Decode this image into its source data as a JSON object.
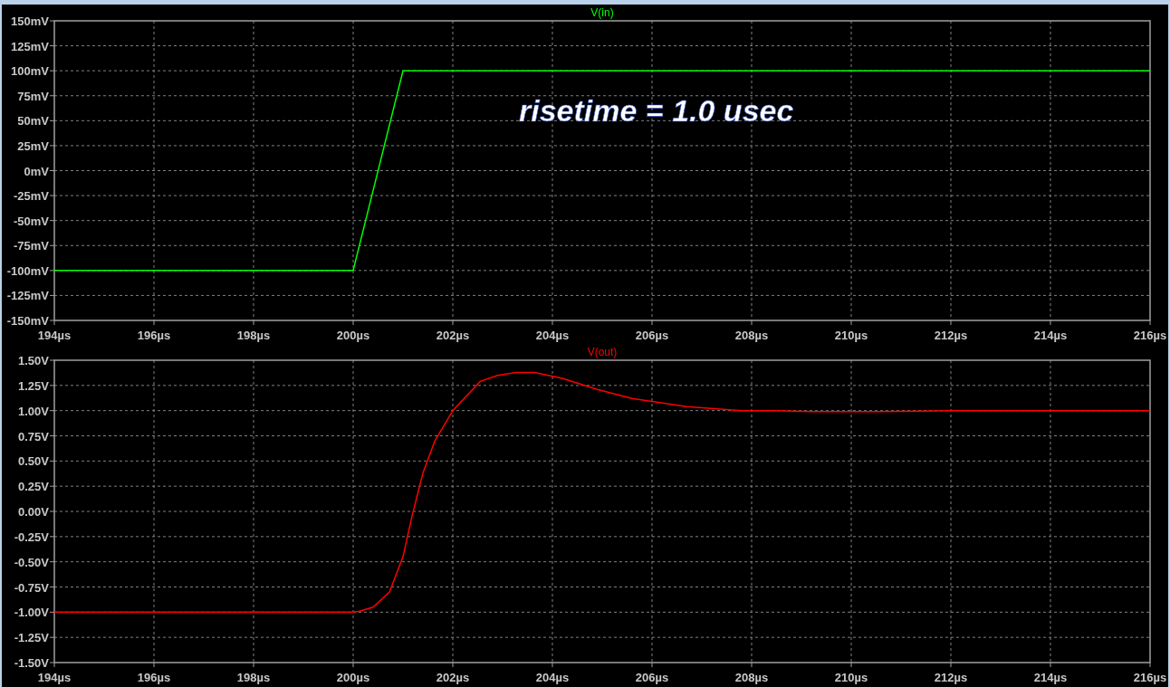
{
  "plots": [
    {
      "chart_data": {
        "type": "line",
        "x": [
          194,
          200,
          201,
          216
        ],
        "series": [
          {
            "name": "V(in)",
            "color": "#00ff00",
            "values": [
              -100,
              -100,
              100,
              100
            ]
          }
        ],
        "xlim": [
          194,
          216
        ],
        "ylim": [
          -150,
          150
        ],
        "xticks": [
          {
            "value": 194,
            "label": "194µs"
          },
          {
            "value": 196,
            "label": "196µs"
          },
          {
            "value": 198,
            "label": "198µs"
          },
          {
            "value": 200,
            "label": "200µs"
          },
          {
            "value": 202,
            "label": "202µs"
          },
          {
            "value": 204,
            "label": "204µs"
          },
          {
            "value": 206,
            "label": "206µs"
          },
          {
            "value": 208,
            "label": "208µs"
          },
          {
            "value": 210,
            "label": "210µs"
          },
          {
            "value": 212,
            "label": "212µs"
          },
          {
            "value": 214,
            "label": "214µs"
          },
          {
            "value": 216,
            "label": "216µs"
          }
        ],
        "yticks": [
          {
            "value": 150,
            "label": "150mV"
          },
          {
            "value": 125,
            "label": "125mV"
          },
          {
            "value": 100,
            "label": "100mV"
          },
          {
            "value": 75,
            "label": "75mV"
          },
          {
            "value": 50,
            "label": "50mV"
          },
          {
            "value": 25,
            "label": "25mV"
          },
          {
            "value": 0,
            "label": "0mV"
          },
          {
            "value": -25,
            "label": "-25mV"
          },
          {
            "value": -50,
            "label": "-50mV"
          },
          {
            "value": -75,
            "label": "-75mV"
          },
          {
            "value": -100,
            "label": "-100mV"
          },
          {
            "value": -125,
            "label": "-125mV"
          },
          {
            "value": -150,
            "label": "-150mV"
          }
        ],
        "grid": true,
        "annotations": [
          "risetime = 1.0 usec"
        ]
      }
    },
    {
      "chart_data": {
        "type": "line",
        "x": [
          194,
          200,
          200.13,
          200.4,
          200.73,
          201.0,
          201.18,
          201.4,
          201.64,
          202.0,
          202.3,
          202.55,
          202.9,
          203.27,
          203.64,
          204.2,
          204.9,
          205.6,
          206.7,
          207.8,
          208.5,
          209.2,
          210.5,
          212,
          214.6,
          216
        ],
        "series": [
          {
            "name": "V(out)",
            "color": "#ff0000",
            "values": [
              -1,
              -1,
              -0.99,
              -0.95,
              -0.8,
              -0.45,
              -0.05,
              0.38,
              0.7,
              1.0,
              1.16,
              1.29,
              1.35,
              1.38,
              1.38,
              1.32,
              1.21,
              1.12,
              1.04,
              1.0,
              1.0,
              0.99,
              0.99,
              1.0,
              1.0,
              1.0
            ]
          }
        ],
        "xlim": [
          194,
          216
        ],
        "ylim": [
          -1.5,
          1.5
        ],
        "xticks": [
          {
            "value": 194,
            "label": "194µs"
          },
          {
            "value": 196,
            "label": "196µs"
          },
          {
            "value": 198,
            "label": "198µs"
          },
          {
            "value": 200,
            "label": "200µs"
          },
          {
            "value": 202,
            "label": "202µs"
          },
          {
            "value": 204,
            "label": "204µs"
          },
          {
            "value": 206,
            "label": "206µs"
          },
          {
            "value": 208,
            "label": "208µs"
          },
          {
            "value": 210,
            "label": "210µs"
          },
          {
            "value": 212,
            "label": "212µs"
          },
          {
            "value": 214,
            "label": "214µs"
          },
          {
            "value": 216,
            "label": "216µs"
          }
        ],
        "yticks": [
          {
            "value": 1.5,
            "label": "1.50V"
          },
          {
            "value": 1.25,
            "label": "1.25V"
          },
          {
            "value": 1.0,
            "label": "1.00V"
          },
          {
            "value": 0.75,
            "label": "0.75V"
          },
          {
            "value": 0.5,
            "label": "0.50V"
          },
          {
            "value": 0.25,
            "label": "0.25V"
          },
          {
            "value": 0,
            "label": "0.00V"
          },
          {
            "value": -0.25,
            "label": "-0.25V"
          },
          {
            "value": -0.5,
            "label": "-0.50V"
          },
          {
            "value": -0.75,
            "label": "-0.75V"
          },
          {
            "value": -1.0,
            "label": "-1.00V"
          },
          {
            "value": -1.25,
            "label": "-1.25V"
          },
          {
            "value": -1.5,
            "label": "-1.50V"
          }
        ],
        "grid": true
      }
    }
  ]
}
